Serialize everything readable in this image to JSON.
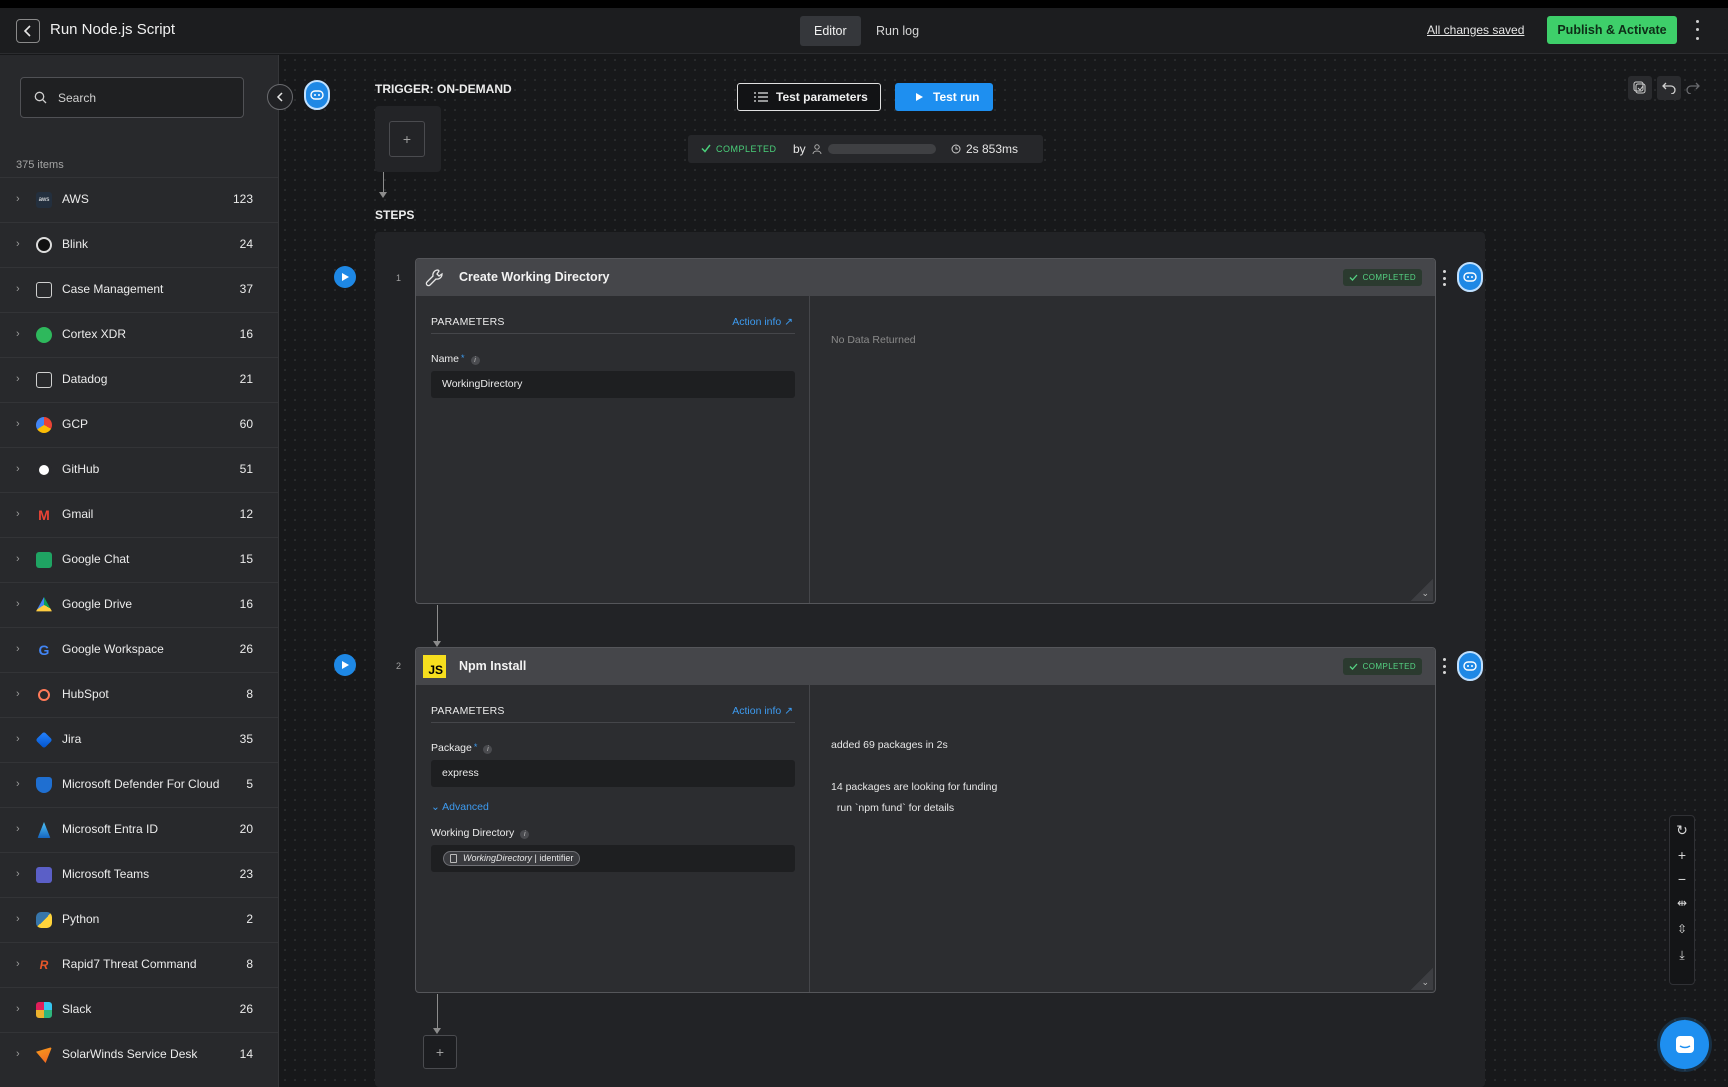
{
  "header": {
    "title": "Run Node.js Script",
    "tabs": [
      {
        "label": "Editor",
        "active": true
      },
      {
        "label": "Run log",
        "active": false
      }
    ],
    "saved_status": "All changes saved",
    "publish_label": "Publish & Activate"
  },
  "sidebar": {
    "search_placeholder": "Search",
    "count": "375 items",
    "items": [
      {
        "label": "AWS",
        "count": "123",
        "icon": "aws-icon"
      },
      {
        "label": "Blink",
        "count": "24",
        "icon": "blink-icon"
      },
      {
        "label": "Case Management",
        "count": "37",
        "icon": "case-management-icon"
      },
      {
        "label": "Cortex XDR",
        "count": "16",
        "icon": "cortex-xdr-icon"
      },
      {
        "label": "Datadog",
        "count": "21",
        "icon": "datadog-icon"
      },
      {
        "label": "GCP",
        "count": "60",
        "icon": "gcp-icon"
      },
      {
        "label": "GitHub",
        "count": "51",
        "icon": "github-icon"
      },
      {
        "label": "Gmail",
        "count": "12",
        "icon": "gmail-icon"
      },
      {
        "label": "Google Chat",
        "count": "15",
        "icon": "google-chat-icon"
      },
      {
        "label": "Google Drive",
        "count": "16",
        "icon": "google-drive-icon"
      },
      {
        "label": "Google Workspace",
        "count": "26",
        "icon": "google-workspace-icon"
      },
      {
        "label": "HubSpot",
        "count": "8",
        "icon": "hubspot-icon"
      },
      {
        "label": "Jira",
        "count": "35",
        "icon": "jira-icon"
      },
      {
        "label": "Microsoft Defender For Cloud",
        "count": "5",
        "icon": "microsoft-defender-icon"
      },
      {
        "label": "Microsoft Entra ID",
        "count": "20",
        "icon": "microsoft-entra-icon"
      },
      {
        "label": "Microsoft Teams",
        "count": "23",
        "icon": "microsoft-teams-icon"
      },
      {
        "label": "Python",
        "count": "2",
        "icon": "python-icon"
      },
      {
        "label": "Rapid7 Threat Command",
        "count": "8",
        "icon": "rapid7-icon"
      },
      {
        "label": "Slack",
        "count": "26",
        "icon": "slack-icon"
      },
      {
        "label": "SolarWinds Service Desk",
        "count": "14",
        "icon": "solarwinds-icon"
      }
    ]
  },
  "canvas": {
    "trigger_label": "TRIGGER: ON-DEMAND",
    "steps_label": "STEPS",
    "test_parameters_label": "Test parameters",
    "test_run_label": "Test run",
    "run_status": {
      "status": "COMPLETED",
      "by_label": "by",
      "duration": "2s 853ms"
    },
    "steps": [
      {
        "number": "1",
        "title": "Create Working Directory",
        "status": "COMPLETED",
        "params_label": "PARAMETERS",
        "action_info_label": "Action info",
        "fields": [
          {
            "label": "Name",
            "value": "WorkingDirectory"
          }
        ],
        "output": "No Data Returned"
      },
      {
        "number": "2",
        "title": "Npm Install",
        "status": "COMPLETED",
        "params_label": "PARAMETERS",
        "action_info_label": "Action info",
        "fields": [
          {
            "label": "Package",
            "value": "express"
          },
          {
            "label": "Working Directory",
            "chip_ref": "WorkingDirectory",
            "chip_suffix": " | identifier"
          }
        ],
        "advanced_label": "Advanced",
        "output_lines": [
          "added 69 packages in 2s",
          "14 packages are looking for funding",
          "  run `npm fund` for details"
        ]
      }
    ]
  },
  "colors": {
    "accent": "#1e8ff0",
    "success": "#3ecf6a",
    "background": "#17181a"
  }
}
